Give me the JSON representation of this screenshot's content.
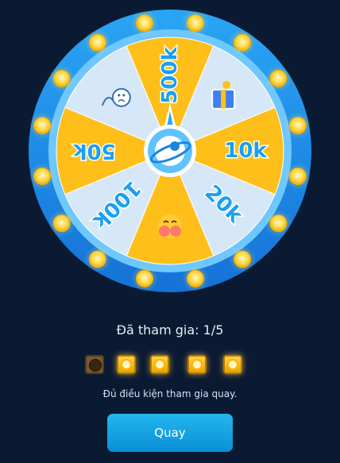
{
  "wheel": {
    "segments": [
      {
        "label": "500k",
        "icon": ""
      },
      {
        "label": "",
        "icon": "gift-box-icon"
      },
      {
        "label": "10k",
        "icon": ""
      },
      {
        "label": "20k",
        "icon": ""
      },
      {
        "label": "",
        "icon": "blush-face-emoji-icon"
      },
      {
        "label": "100k",
        "icon": ""
      },
      {
        "label": "50k",
        "icon": ""
      },
      {
        "label": "",
        "icon": "sad-face-icon"
      }
    ],
    "hub_icon": "planet-logo-icon",
    "colors": {
      "yellow": "#ffbf1a",
      "light": "#d6e8f7",
      "ring": "#1e8fe6",
      "ring_inner": "#6ec7ff",
      "coin": "#ffd84a",
      "text": "#1aa0f0"
    }
  },
  "participation": {
    "label": "Đã tham gia: 1/5",
    "used": 1,
    "total": 5
  },
  "eligibility_text": "Đủ điều kiện tham gia quay.",
  "spin_button": {
    "label": "Quay"
  }
}
